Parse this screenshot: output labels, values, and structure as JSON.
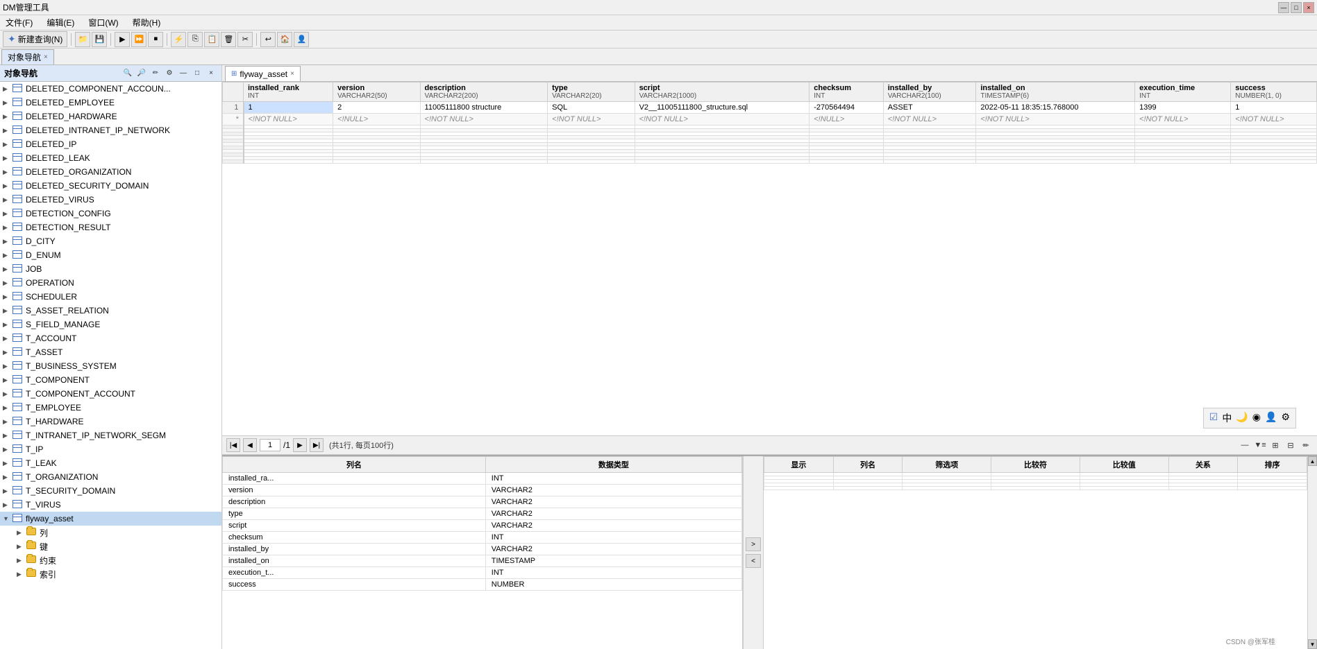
{
  "app": {
    "title": "DM管理工具",
    "title_buttons": [
      "—",
      "□",
      "×"
    ]
  },
  "menu": {
    "items": [
      "文件(F)",
      "编辑(E)",
      "窗口(W)",
      "帮助(H)"
    ]
  },
  "toolbar": {
    "new_query_label": "新建查询(N)",
    "icons": [
      "folder-open",
      "save",
      "run",
      "debug",
      "stop",
      "format",
      "copy",
      "paste",
      "delete",
      "cut",
      "undo",
      "home",
      "person"
    ]
  },
  "sidebar": {
    "title": "对象导航",
    "tab_label": "对象导航",
    "tab_close": "×",
    "toolbar_icons": [
      "search",
      "search2",
      "edit",
      "settings",
      "minus",
      "square",
      "x"
    ],
    "tree_items": [
      {
        "label": "DELETED_COMPONENT_ACCOUN...",
        "type": "table",
        "level": 1
      },
      {
        "label": "DELETED_EMPLOYEE",
        "type": "table",
        "level": 1
      },
      {
        "label": "DELETED_HARDWARE",
        "type": "table",
        "level": 1
      },
      {
        "label": "DELETED_INTRANET_IP_NETWORK",
        "type": "table",
        "level": 1
      },
      {
        "label": "DELETED_IP",
        "type": "table",
        "level": 1
      },
      {
        "label": "DELETED_LEAK",
        "type": "table",
        "level": 1
      },
      {
        "label": "DELETED_ORGANIZATION",
        "type": "table",
        "level": 1
      },
      {
        "label": "DELETED_SECURITY_DOMAIN",
        "type": "table",
        "level": 1
      },
      {
        "label": "DELETED_VIRUS",
        "type": "table",
        "level": 1
      },
      {
        "label": "DETECTION_CONFIG",
        "type": "table",
        "level": 1
      },
      {
        "label": "DETECTION_RESULT",
        "type": "table",
        "level": 1
      },
      {
        "label": "D_CITY",
        "type": "table",
        "level": 1
      },
      {
        "label": "D_ENUM",
        "type": "table",
        "level": 1
      },
      {
        "label": "JOB",
        "type": "table",
        "level": 1
      },
      {
        "label": "OPERATION",
        "type": "table",
        "level": 1
      },
      {
        "label": "SCHEDULER",
        "type": "table",
        "level": 1
      },
      {
        "label": "S_ASSET_RELATION",
        "type": "table",
        "level": 1
      },
      {
        "label": "S_FIELD_MANAGE",
        "type": "table",
        "level": 1
      },
      {
        "label": "T_ACCOUNT",
        "type": "table",
        "level": 1
      },
      {
        "label": "T_ASSET",
        "type": "table",
        "level": 1
      },
      {
        "label": "T_BUSINESS_SYSTEM",
        "type": "table",
        "level": 1
      },
      {
        "label": "T_COMPONENT",
        "type": "table",
        "level": 1
      },
      {
        "label": "T_COMPONENT_ACCOUNT",
        "type": "table",
        "level": 1
      },
      {
        "label": "T_EMPLOYEE",
        "type": "table",
        "level": 1
      },
      {
        "label": "T_HARDWARE",
        "type": "table",
        "level": 1
      },
      {
        "label": "T_INTRANET_IP_NETWORK_SEGM",
        "type": "table",
        "level": 1
      },
      {
        "label": "T_IP",
        "type": "table",
        "level": 1
      },
      {
        "label": "T_LEAK",
        "type": "table",
        "level": 1
      },
      {
        "label": "T_ORGANIZATION",
        "type": "table",
        "level": 1
      },
      {
        "label": "T_SECURITY_DOMAIN",
        "type": "table",
        "level": 1
      },
      {
        "label": "T_VIRUS",
        "type": "table",
        "level": 1
      },
      {
        "label": "flyway_asset",
        "type": "table",
        "level": 1,
        "selected": true,
        "expanded": true
      },
      {
        "label": "列",
        "type": "folder",
        "level": 2
      },
      {
        "label": "键",
        "type": "folder",
        "level": 2
      },
      {
        "label": "约束",
        "type": "folder",
        "level": 2
      },
      {
        "label": "索引",
        "type": "folder",
        "level": 2
      }
    ]
  },
  "query_tab": {
    "label": "flyway_asset",
    "close": "×"
  },
  "table": {
    "columns": [
      {
        "name": "installed_rank",
        "type": "INT"
      },
      {
        "name": "version",
        "type": "VARCHAR2(50)"
      },
      {
        "name": "description",
        "type": "VARCHAR2(200)"
      },
      {
        "name": "type",
        "type": "VARCHAR2(20)"
      },
      {
        "name": "script",
        "type": "VARCHAR2(1000)"
      },
      {
        "name": "checksum",
        "type": "INT"
      },
      {
        "name": "installed_by",
        "type": "VARCHAR2(100)"
      },
      {
        "name": "installed_on",
        "type": "TIMESTAMP(6)"
      },
      {
        "name": "execution_time",
        "type": "INT"
      },
      {
        "name": "success",
        "type": "NUMBER(1, 0)"
      }
    ],
    "rows": [
      {
        "row_num": "1",
        "installed_rank": "1",
        "version": "2",
        "description": "11005111800 structure",
        "type": "SQL",
        "script": "V2__11005111800_structure.sql",
        "checksum": "-270564494",
        "installed_by": "ASSET",
        "installed_on": "2022-05-11 18:35:15.768000",
        "execution_time": "1399",
        "success": "1"
      }
    ],
    "new_row": {
      "installed_rank": "<!NOT NULL>",
      "version": "<!NULL>",
      "description": "<!NOT NULL>",
      "type": "<!NOT NULL>",
      "script": "<!NOT NULL>",
      "checksum": "<!NULL>",
      "installed_by": "<!NOT NULL>",
      "installed_on": "<!NOT NULL>",
      "execution_time": "<!NOT NULL>",
      "success": "<!NOT NULL>"
    }
  },
  "pagination": {
    "first": "◀◀",
    "prev": "◀",
    "page_input": "1",
    "page_total": "/1",
    "next": "▶",
    "last": "▶▶",
    "info": "(共1行, 每页100行)"
  },
  "bottom_panel": {
    "columns_header": [
      "列名",
      "数据类型"
    ],
    "columns": [
      {
        "name": "installed_ra...",
        "type": "INT"
      },
      {
        "name": "version",
        "type": "VARCHAR2"
      },
      {
        "name": "description",
        "type": "VARCHAR2"
      },
      {
        "name": "type",
        "type": "VARCHAR2"
      },
      {
        "name": "script",
        "type": "VARCHAR2"
      },
      {
        "name": "checksum",
        "type": "INT"
      },
      {
        "name": "installed_by",
        "type": "VARCHAR2"
      },
      {
        "name": "installed_on",
        "type": "TIMESTAMP"
      },
      {
        "name": "execution_t...",
        "type": "INT"
      },
      {
        "name": "success",
        "type": "NUMBER"
      }
    ],
    "filter_headers": [
      "显示",
      "列名",
      "筛选项",
      "比较符",
      "比较值",
      "关系",
      "排序"
    ],
    "arrow_up": ">",
    "arrow_down": "<"
  },
  "overlay_icons": [
    "☑",
    "中",
    "🌙",
    "◉",
    "👤",
    "⚙"
  ],
  "watermark": "CSDN @张军桂"
}
